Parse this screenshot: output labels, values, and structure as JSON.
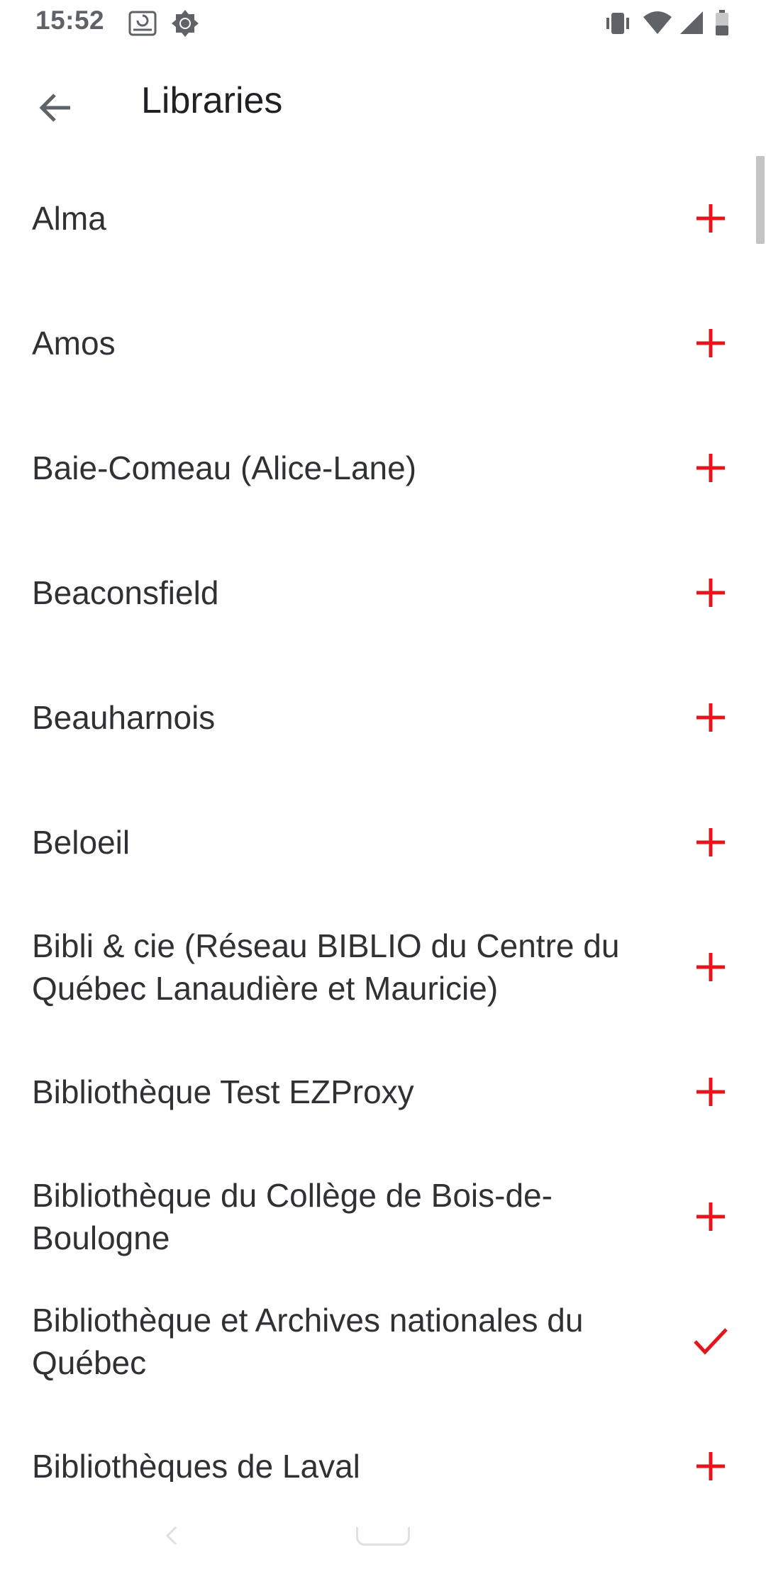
{
  "status_bar": {
    "time": "15:52",
    "left_icons": [
      "alert-drive-icon",
      "brightness-icon"
    ],
    "right_icons": [
      "vibrate-icon",
      "wifi-icon",
      "cell-signal-icon",
      "battery-icon"
    ]
  },
  "app_bar": {
    "back_icon": "arrow-back-icon",
    "title": "Libraries"
  },
  "accent_color": "#e8141b",
  "libraries": [
    {
      "name": "Alma",
      "state": "add"
    },
    {
      "name": "Amos",
      "state": "add"
    },
    {
      "name": "Baie-Comeau (Alice-Lane)",
      "state": "add"
    },
    {
      "name": "Beaconsfield",
      "state": "add"
    },
    {
      "name": "Beauharnois",
      "state": "add"
    },
    {
      "name": "Beloeil",
      "state": "add"
    },
    {
      "name": "Bibli & cie (Réseau BIBLIO du Centre du Québec Lanaudière et Mauricie)",
      "state": "add"
    },
    {
      "name": "Bibliothèque Test EZProxy",
      "state": "add"
    },
    {
      "name": "Bibliothèque du Collège de Bois-de-Boulogne",
      "state": "add"
    },
    {
      "name": "Bibliothèque et Archives nationales du Québec",
      "state": "selected"
    },
    {
      "name": "Bibliothèques de Laval",
      "state": "add"
    }
  ],
  "nav_bar": {
    "icons": [
      "nav-back-icon",
      "nav-home-pill-icon"
    ]
  }
}
